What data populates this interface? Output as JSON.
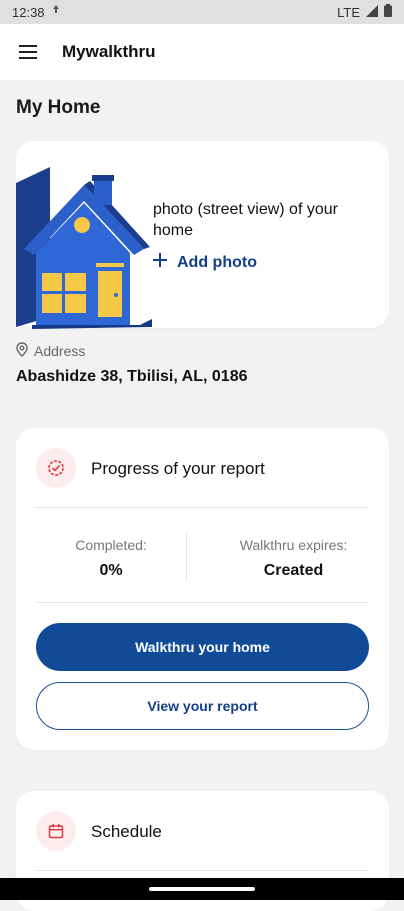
{
  "statusbar": {
    "time": "12:38",
    "network": "LTE"
  },
  "appbar": {
    "title": "Mywalkthru"
  },
  "page": {
    "title": "My Home"
  },
  "photo_card": {
    "prompt": "photo (street view) of your home",
    "add_photo_label": "Add photo"
  },
  "address": {
    "label": "Address",
    "value": "Abashidze 38, Tbilisi, AL, 0186"
  },
  "progress": {
    "heading": "Progress of your report",
    "completed_label": "Completed:",
    "completed_value": "0%",
    "expires_label": "Walkthru expires:",
    "expires_value": "Created",
    "primary_button": "Walkthru your home",
    "secondary_button": "View your report"
  },
  "schedule": {
    "heading": "Schedule"
  },
  "colors": {
    "primary": "#114a96",
    "accent_red": "#d93a48",
    "icon_bg": "#fdecee",
    "background": "#f2f2f2"
  },
  "icons": [
    "menu-icon",
    "camera-icon",
    "wifi-icon",
    "signal-icon",
    "battery-icon",
    "plus-icon",
    "location-pin-icon",
    "check-badge-icon",
    "calendar-icon"
  ]
}
